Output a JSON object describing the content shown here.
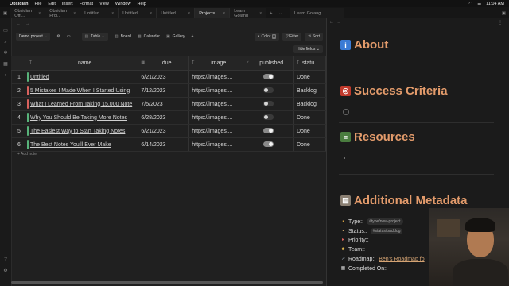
{
  "menubar": {
    "app": "Obsidian",
    "items": [
      "File",
      "Edit",
      "Insert",
      "Format",
      "View",
      "Window",
      "Help"
    ],
    "time": "11:04 AM"
  },
  "tabs": [
    {
      "label": "Obsidian Offi...",
      "active": false
    },
    {
      "label": "Obsidian Proj...",
      "active": false
    },
    {
      "label": "Untitled",
      "active": false
    },
    {
      "label": "Untitled",
      "active": false
    },
    {
      "label": "Untitled",
      "active": false
    },
    {
      "label": "Projects",
      "active": true
    },
    {
      "label": "Learn Golang",
      "active": false
    }
  ],
  "right_tab": "Learn Golang",
  "toolbar": {
    "project_select": "Demo project",
    "views": [
      "Table",
      "Board",
      "Calendar",
      "Gallery"
    ],
    "active_view": "Table",
    "add_view": "+",
    "color_label": "Color",
    "filter_label": "Filter",
    "sort_label": "Sort",
    "hide_fields_label": "Hide fields"
  },
  "table": {
    "columns": [
      "name",
      "due",
      "image",
      "published",
      "statu"
    ],
    "rows": [
      {
        "num": "1",
        "name": "Untitled",
        "due": "6/21/2023",
        "image": "https://images....",
        "published": true,
        "status": "Done",
        "color": "#58b37a"
      },
      {
        "num": "2",
        "name": "5 Mistakes I Made When I Started Using",
        "due": "7/12/2023",
        "image": "https://images....",
        "published": false,
        "status": "Backlog",
        "color": "#d9625e"
      },
      {
        "num": "3",
        "name": "What I Learned From Taking 15,000 Note",
        "due": "7/5/2023",
        "image": "https://images....",
        "published": false,
        "status": "Backlog",
        "color": "#d9625e"
      },
      {
        "num": "4",
        "name": "Why You Should Be Taking More Notes",
        "due": "6/28/2023",
        "image": "https://images....",
        "published": false,
        "status": "Done",
        "color": "#58b37a"
      },
      {
        "num": "5",
        "name": "The Easiest Way to Start Taking Notes",
        "due": "6/21/2023",
        "image": "https://images....",
        "published": true,
        "status": "Done",
        "color": "#58b37a"
      },
      {
        "num": "6",
        "name": "The Best Notes You'll Ever Make",
        "due": "6/14/2023",
        "image": "https://images....",
        "published": true,
        "status": "Done",
        "color": "#58b37a"
      }
    ],
    "add_note_label": "+ Add note"
  },
  "note": {
    "headings": [
      {
        "label": "About",
        "icon": "info-icon",
        "color": "#3a7bd5",
        "glyph": "i"
      },
      {
        "label": "Success Criteria",
        "icon": "target-icon",
        "color": "#c0392b",
        "glyph": "◎"
      },
      {
        "label": "Resources",
        "icon": "books-icon",
        "color": "#4a7c3f",
        "glyph": "≡"
      },
      {
        "label": "Additional Metadata",
        "icon": "cabinet-icon",
        "color": "#8a7f72",
        "glyph": "▤"
      }
    ],
    "meta": [
      {
        "label": "Type::",
        "value": "#type/new-project",
        "kind": "tag",
        "icon": "folder-icon",
        "glyph": "▪",
        "color": "#d9a441"
      },
      {
        "label": "Status::",
        "value": "#status/backlog",
        "kind": "tag",
        "icon": "clipboard-icon",
        "glyph": "▪",
        "color": "#c9a36b"
      },
      {
        "label": "Priority::",
        "value": "",
        "kind": "none",
        "icon": "flag-icon",
        "glyph": "▸",
        "color": "#d9625e"
      },
      {
        "label": "Team::",
        "value": "",
        "kind": "none",
        "icon": "team-icon",
        "glyph": "☻",
        "color": "#e0b64a"
      },
      {
        "label": "Roadmap::",
        "value": "Ben's Roadmap fo",
        "kind": "link",
        "icon": "roadmap-icon",
        "glyph": "↗",
        "color": "#9aa7b3"
      },
      {
        "label": "Completed On::",
        "value": "",
        "kind": "none",
        "icon": "calendar-icon",
        "glyph": "▦",
        "color": "#cfcfcf"
      }
    ]
  },
  "colors": {
    "accent_orange": "#e39b6b",
    "done_green": "#58b37a",
    "backlog_red": "#d9625e"
  }
}
